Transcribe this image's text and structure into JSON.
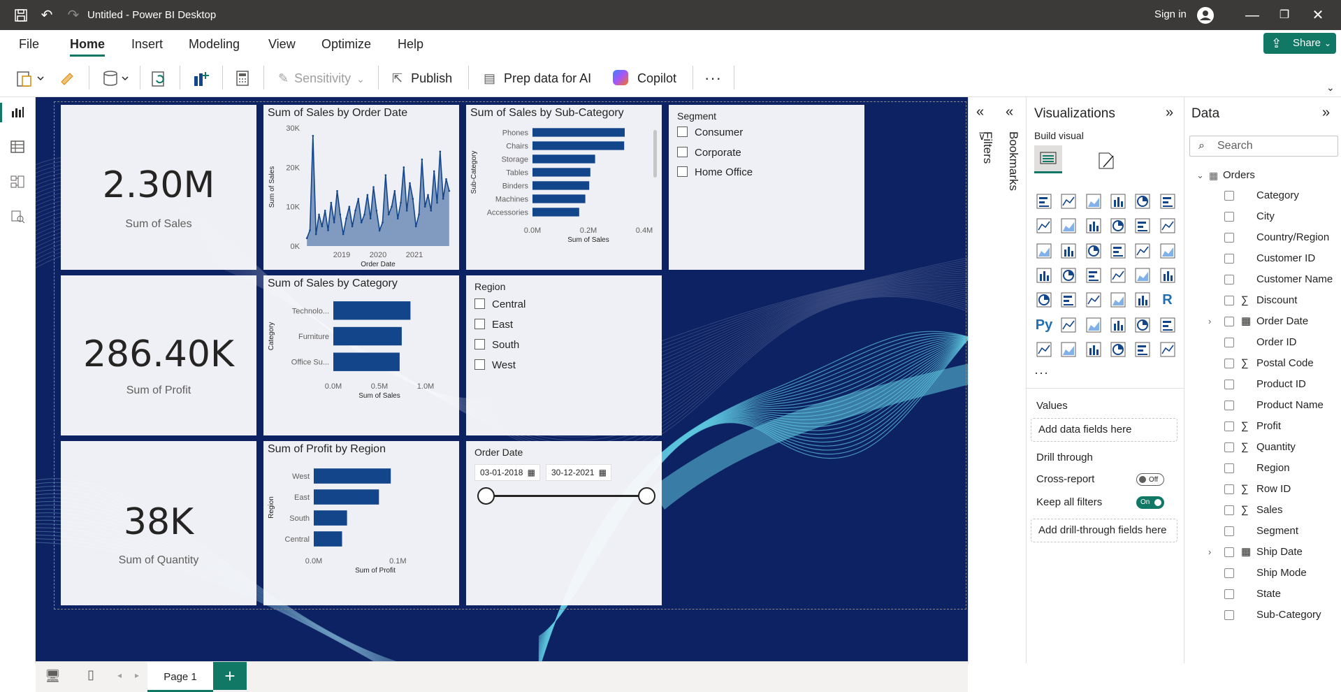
{
  "titlebar": {
    "title": "Untitled - Power BI Desktop",
    "signin": "Sign in"
  },
  "menu": {
    "items": [
      "File",
      "Home",
      "Insert",
      "Modeling",
      "View",
      "Optimize",
      "Help"
    ],
    "active": "Home",
    "share": "Share"
  },
  "ribbon": {
    "sensitivity": "Sensitivity",
    "publish": "Publish",
    "prep": "Prep data for AI",
    "copilot": "Copilot",
    "more": "···"
  },
  "kpis": [
    {
      "value": "2.30M",
      "label": "Sum of Sales"
    },
    {
      "value": "286.40K",
      "label": "Sum of Profit"
    },
    {
      "value": "38K",
      "label": "Sum of Quantity"
    }
  ],
  "slicers": {
    "segment": {
      "title": "Segment",
      "items": [
        "Consumer",
        "Corporate",
        "Home Office"
      ]
    },
    "region": {
      "title": "Region",
      "items": [
        "Central",
        "East",
        "South",
        "West"
      ]
    },
    "order_date": {
      "title": "Order Date",
      "start": "03-01-2018",
      "end": "30-12-2021"
    }
  },
  "chart_data": [
    {
      "type": "line",
      "title": "Sum of Sales by Order Date",
      "xlabel": "Order Date",
      "ylabel": "Sum of Sales",
      "yticks": [
        "30K",
        "20K",
        "10K",
        "0K"
      ],
      "xticks": [
        "2019",
        "2020",
        "2021"
      ],
      "ylim": [
        0,
        30000
      ],
      "x": [
        "2018-01",
        "2018-02",
        "2018-03",
        "2018-04",
        "2018-05",
        "2018-06",
        "2018-07",
        "2018-08",
        "2018-09",
        "2018-10",
        "2018-11",
        "2018-12",
        "2019-01",
        "2019-02",
        "2019-03",
        "2019-04",
        "2019-05",
        "2019-06",
        "2019-07",
        "2019-08",
        "2019-09",
        "2019-10",
        "2019-11",
        "2019-12",
        "2020-01",
        "2020-02",
        "2020-03",
        "2020-04",
        "2020-05",
        "2020-06",
        "2020-07",
        "2020-08",
        "2020-09",
        "2020-10",
        "2020-11",
        "2020-12",
        "2021-01",
        "2021-02",
        "2021-03",
        "2021-04",
        "2021-05",
        "2021-06",
        "2021-07",
        "2021-08",
        "2021-09",
        "2021-10",
        "2021-11",
        "2021-12"
      ],
      "values": [
        2000,
        4000,
        28000,
        3000,
        8000,
        5000,
        9000,
        4000,
        11000,
        6000,
        14000,
        8000,
        3000,
        7000,
        10000,
        5000,
        9000,
        12000,
        6000,
        8000,
        13000,
        7000,
        15000,
        9000,
        4000,
        6000,
        18000,
        8000,
        10000,
        14000,
        7000,
        11000,
        20000,
        9000,
        16000,
        12000,
        5000,
        8000,
        22000,
        10000,
        13000,
        9000,
        19000,
        11000,
        24000,
        12000,
        17000,
        14000
      ]
    },
    {
      "type": "bar",
      "title": "Sum of Sales by Sub-Category",
      "xlabel": "Sum of Sales",
      "ylabel": "Sub-Category",
      "categories": [
        "Phones",
        "Chairs",
        "Storage",
        "Tables",
        "Binders",
        "Machines",
        "Accessories"
      ],
      "values": [
        330000,
        328000,
        224000,
        207000,
        203000,
        189000,
        167000
      ],
      "xticks": [
        "0.0M",
        "0.2M",
        "0.4M"
      ],
      "xlim": [
        0,
        400000
      ]
    },
    {
      "type": "bar",
      "title": "Sum of Sales by Category",
      "xlabel": "Sum of Sales",
      "ylabel": "Category",
      "categories": [
        "Technolo...",
        "Furniture",
        "Office Su..."
      ],
      "values": [
        836000,
        742000,
        719000
      ],
      "xticks": [
        "0.0M",
        "0.5M",
        "1.0M"
      ],
      "xlim": [
        0,
        1000000
      ]
    },
    {
      "type": "bar",
      "title": "Sum of Profit by Region",
      "xlabel": "Sum of Profit",
      "ylabel": "Region",
      "categories": [
        "West",
        "East",
        "South",
        "Central"
      ],
      "values": [
        108000,
        91500,
        46700,
        39700
      ],
      "xticks": [
        "0.0M",
        "0.1M"
      ],
      "xlim": [
        0,
        100000
      ]
    }
  ],
  "panes": {
    "filters": "Filters",
    "bookmarks": "Bookmarks",
    "visualizations": {
      "title": "Visualizations",
      "build_visual": "Build visual",
      "values_label": "Values",
      "values_well": "Add data fields here",
      "drill_through": "Drill through",
      "cross_report": "Cross-report",
      "cross_report_state": "Off",
      "keep_filters": "Keep all filters",
      "keep_filters_state": "On",
      "drill_well": "Add drill-through fields here",
      "more": "···"
    },
    "data": {
      "title": "Data",
      "search_placeholder": "Search",
      "table": "Orders",
      "fields": [
        {
          "name": "Category",
          "type": "text"
        },
        {
          "name": "City",
          "type": "text"
        },
        {
          "name": "Country/Region",
          "type": "text"
        },
        {
          "name": "Customer ID",
          "type": "text"
        },
        {
          "name": "Customer Name",
          "type": "text"
        },
        {
          "name": "Discount",
          "type": "sum"
        },
        {
          "name": "Order Date",
          "type": "date"
        },
        {
          "name": "Order ID",
          "type": "text"
        },
        {
          "name": "Postal Code",
          "type": "sum"
        },
        {
          "name": "Product ID",
          "type": "text"
        },
        {
          "name": "Product Name",
          "type": "text"
        },
        {
          "name": "Profit",
          "type": "sum"
        },
        {
          "name": "Quantity",
          "type": "sum"
        },
        {
          "name": "Region",
          "type": "text"
        },
        {
          "name": "Row ID",
          "type": "sum"
        },
        {
          "name": "Sales",
          "type": "sum"
        },
        {
          "name": "Segment",
          "type": "text"
        },
        {
          "name": "Ship Date",
          "type": "date"
        },
        {
          "name": "Ship Mode",
          "type": "text"
        },
        {
          "name": "State",
          "type": "text"
        },
        {
          "name": "Sub-Category",
          "type": "text"
        }
      ]
    }
  },
  "pages": {
    "current": "Page 1",
    "add": "+"
  },
  "colors": {
    "accent": "#117865",
    "canvas_bg": "#0d2263",
    "bar": "#12458a",
    "wave": "#5ec8e0"
  }
}
